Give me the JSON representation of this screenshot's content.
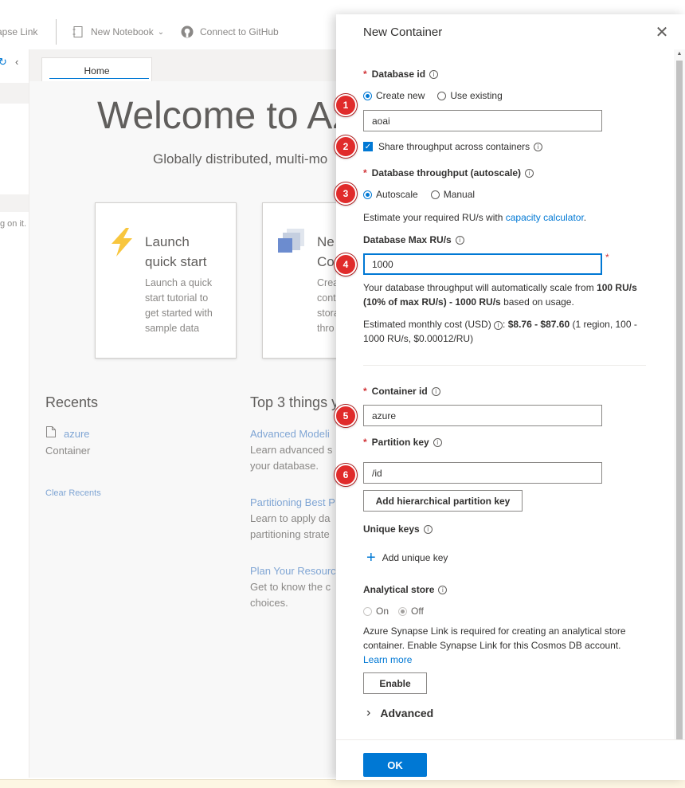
{
  "toolbar": {
    "synapse_link": "apse Link",
    "new_notebook": "New Notebook",
    "connect_github": "Connect to GitHub"
  },
  "left_strip": {
    "text": "g on it."
  },
  "home": {
    "tab_label": "Home",
    "welcome": "Welcome to Az",
    "subtitle": "Globally distributed, multi-mo",
    "cards": [
      {
        "title": "Launch\nquick start",
        "desc": "Launch a quick\nstart tutorial to\nget started with\nsample data"
      },
      {
        "title": "Ne\nCo",
        "desc": "Crea\ncont\nstora\nthro"
      }
    ],
    "recents": {
      "title": "Recents",
      "item_name": "azure",
      "item_type": "Container",
      "clear": "Clear Recents"
    },
    "top3": {
      "title": "Top 3 things y",
      "items": [
        {
          "link": "Advanced Modeli",
          "desc": "Learn advanced s\nyour database."
        },
        {
          "link": "Partitioning Best P",
          "desc": "Learn to apply da\npartitioning strate"
        },
        {
          "link": "Plan Your Resourc",
          "desc": "Get to know the c\nchoices."
        }
      ]
    }
  },
  "panel": {
    "title": "New Container",
    "database_id_label": "Database id",
    "create_new": "Create new",
    "use_existing": "Use existing",
    "database_id_value": "aoai",
    "share_throughput": "Share throughput across containers",
    "db_throughput_label": "Database throughput (autoscale)",
    "autoscale": "Autoscale",
    "manual": "Manual",
    "estimate_prefix": "Estimate your required RU/s with ",
    "capacity_calculator": "capacity calculator",
    "estimate_suffix": ".",
    "db_max_rus_label": "Database Max RU/s",
    "max_rus_value": "1000",
    "scale_text_1": "Your database throughput will automatically scale from ",
    "scale_bold_1": "100 RU/s (10% of max RU/s) - 1000 RU/s",
    "scale_text_2": " based on usage.",
    "cost_prefix": "Estimated monthly cost (USD) ",
    "cost_bold": "$8.76 - $87.60",
    "cost_suffix": " (1 region, 100 - 1000 RU/s, $0.00012/RU)",
    "container_id_label": "Container id",
    "container_id_value": "azure",
    "partition_key_label": "Partition key",
    "partition_key_value": "/id",
    "add_hierarchical": "Add hierarchical partition key",
    "unique_keys_label": "Unique keys",
    "add_unique_key": "Add unique key",
    "analytical_store_label": "Analytical store",
    "on": "On",
    "off": "Off",
    "synapse_text": "Azure Synapse Link is required for creating an analytical store container. Enable Synapse Link for this Cosmos DB account. ",
    "learn_more": "Learn more",
    "enable": "Enable",
    "advanced": "Advanced",
    "ok": "OK"
  },
  "badges": [
    "1",
    "2",
    "3",
    "4",
    "5",
    "6"
  ],
  "required_star": "*",
  "info_glyph": "i",
  "colors": {
    "accent": "#0078d4",
    "badge": "#e02b2b",
    "required": "#d13438",
    "link": "#0078d4"
  }
}
